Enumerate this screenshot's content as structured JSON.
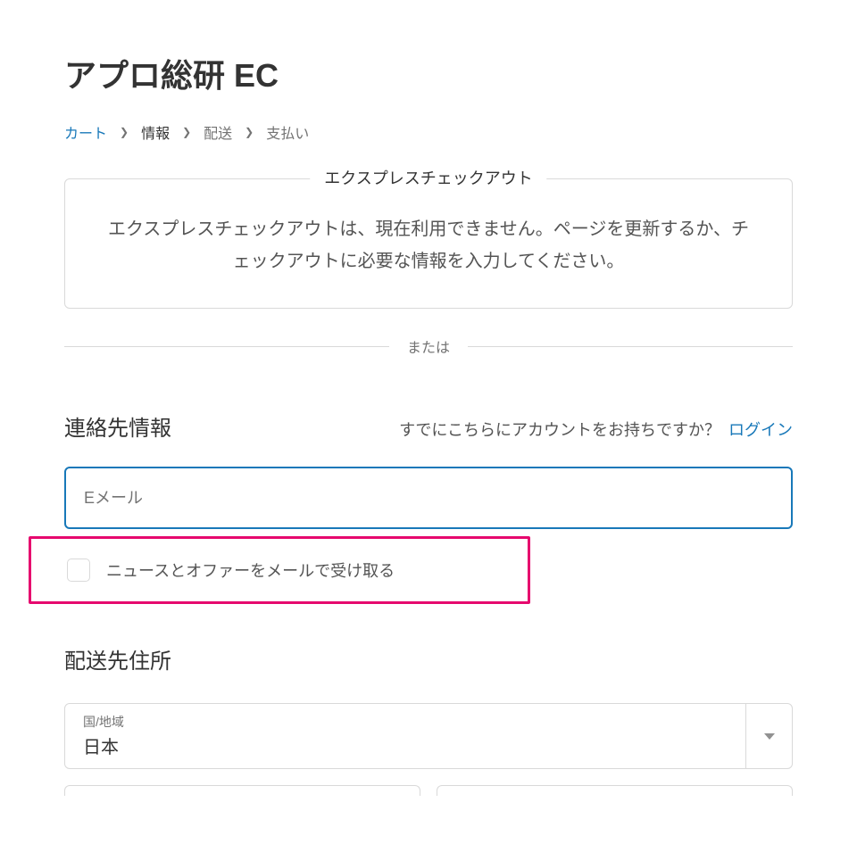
{
  "header": {
    "title": "アプロ総研 EC"
  },
  "breadcrumb": {
    "items": [
      {
        "label": "カート",
        "state": "link"
      },
      {
        "label": "情報",
        "state": "current"
      },
      {
        "label": "配送",
        "state": "future"
      },
      {
        "label": "支払い",
        "state": "future"
      }
    ]
  },
  "express": {
    "legend": "エクスプレスチェックアウト",
    "message": "エクスプレスチェックアウトは、現在利用できません。ページを更新するか、チェックアウトに必要な情報を入力してください。"
  },
  "divider": {
    "text": "または"
  },
  "contact": {
    "heading": "連絡先情報",
    "prompt": "すでにこちらにアカウントをお持ちですか？",
    "login": "ログイン",
    "email_placeholder": "Eメール",
    "newsletter_label": "ニュースとオファーをメールで受け取る"
  },
  "shipping": {
    "heading": "配送先住所",
    "country_label": "国/地域",
    "country_value": "日本"
  }
}
